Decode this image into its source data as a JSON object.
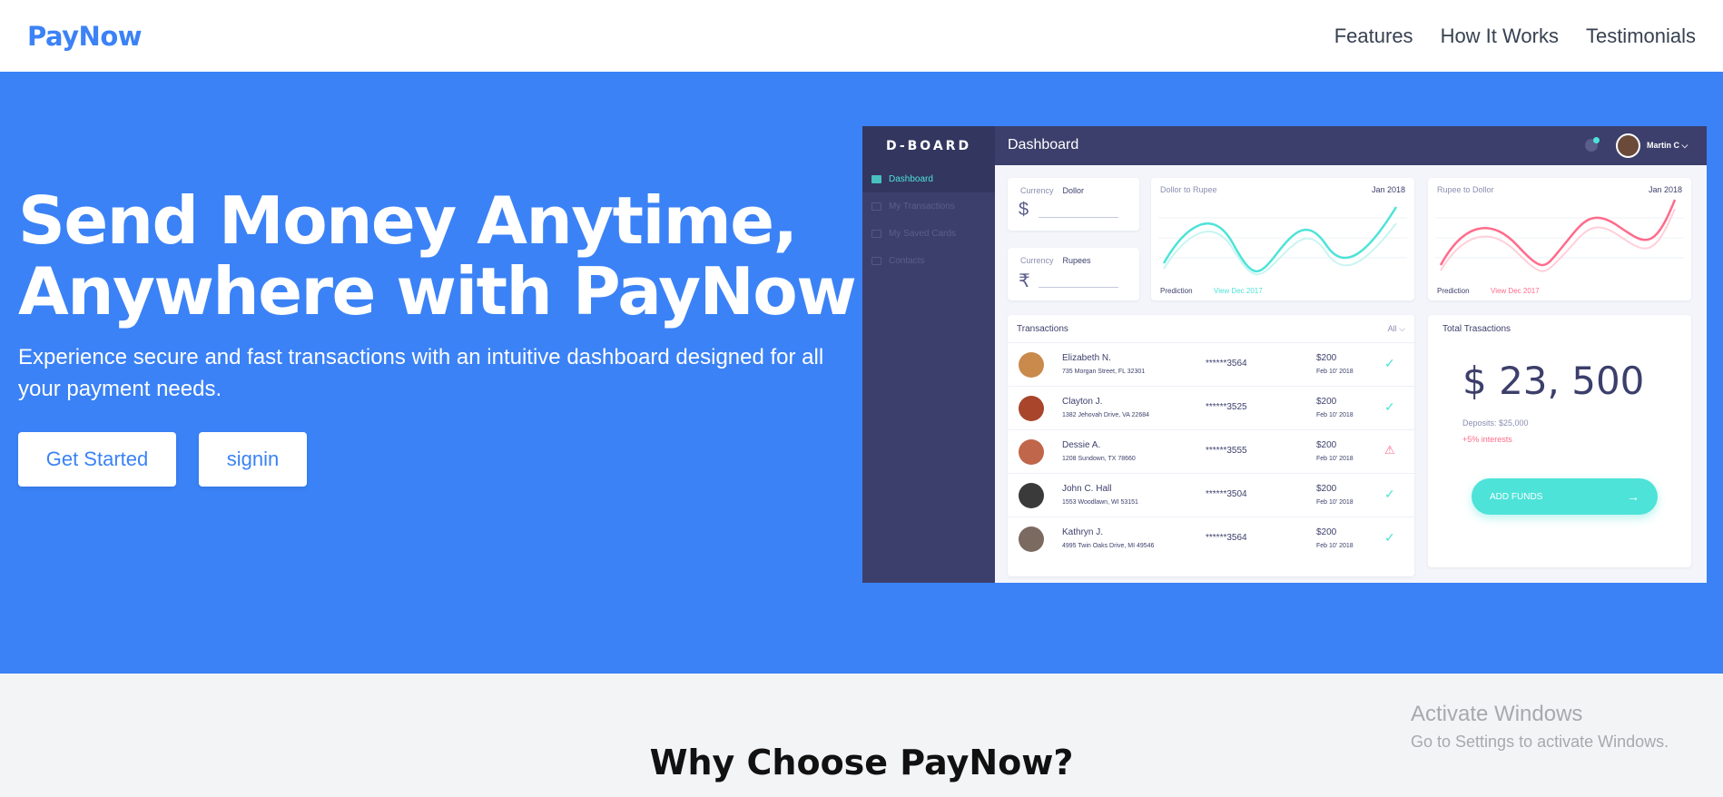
{
  "nav": {
    "brand": "PayNow",
    "links": [
      "Features",
      "How It Works",
      "Testimonials"
    ]
  },
  "hero": {
    "title_line1": "Send Money Anytime,",
    "title_line2": "Anywhere with PayNow",
    "subtitle": "Experience secure and fast transactions with an intuitive dashboard designed for all your payment needs.",
    "btn_start": "Get Started",
    "btn_signin": "signin",
    "bg_color": "#3b82f6"
  },
  "dashboard": {
    "logo": "D-BOARD",
    "title": "Dashboard",
    "user": "Martin C",
    "menu": [
      "Dashboard",
      "My Transactions",
      "My Saved Cards",
      "Contacts"
    ],
    "currency1": {
      "label": "Currency",
      "value": "Dollor",
      "symbol": "$"
    },
    "currency2": {
      "label": "Currency",
      "value": "Rupees",
      "symbol": "₹"
    },
    "chart1": {
      "title": "Dollor to Rupee",
      "date": "Jan 2018",
      "prediction": "Prediction",
      "view": "View Dec 2017",
      "color": "#4ee3d8"
    },
    "chart2": {
      "title": "Rupee to Dollor",
      "date": "Jan 2018",
      "prediction": "Prediction",
      "view": "View Dec 2017",
      "color": "#ff6b8b"
    },
    "transactions": {
      "title": "Transactions",
      "filter": "All",
      "rows": [
        {
          "name": "Elizabeth N.",
          "address": "735 Morgan Street, FL 32301",
          "card": "******3564",
          "amount": "$200",
          "date": "Feb 10' 2018",
          "status": "ok"
        },
        {
          "name": "Clayton J.",
          "address": "1382 Jehovah Drive, VA 22684",
          "card": "******3525",
          "amount": "$200",
          "date": "Feb 10' 2018",
          "status": "ok"
        },
        {
          "name": "Dessie A.",
          "address": "1208 Sundown, TX 78660",
          "card": "******3555",
          "amount": "$200",
          "date": "Feb 10' 2018",
          "status": "warn"
        },
        {
          "name": "John C. Hall",
          "address": "1553 Woodlawn, WI 53151",
          "card": "******3504",
          "amount": "$200",
          "date": "Feb 10' 2018",
          "status": "ok"
        },
        {
          "name": "Kathryn J.",
          "address": "4995 Twin Oaks Drive, MI 49546",
          "card": "******3564",
          "amount": "$200",
          "date": "Feb 10' 2018",
          "status": "ok"
        }
      ]
    },
    "total": {
      "title": "Total Trasactions",
      "amount": "$ 23, 500",
      "deposits": "Deposits: $25,000",
      "interest": "+5% interests",
      "button": "ADD FUNDS"
    }
  },
  "why": {
    "title": "Why Choose PayNow?"
  },
  "watermark": {
    "line1": "Activate Windows",
    "line2": "Go to Settings to activate Windows."
  }
}
